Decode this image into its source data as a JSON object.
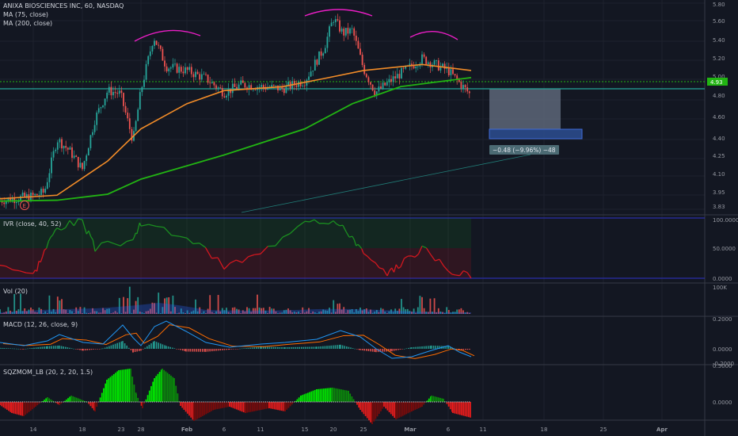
{
  "header": {
    "symbol_line": "ANIXA BIOSCIENCES INC, 60, NASDAQ",
    "ma75_label": "MA (75, close)",
    "ma200_label": "MA (200, close)"
  },
  "panes": {
    "ivr_label": "IVR (close, 40, 52)",
    "vol_label": "Vol (20)",
    "macd_label": "MACD (12, 26, close, 9)",
    "sqz_label": "SQZMOM_LB (20, 2, 20, 1.5)"
  },
  "price_axis": [
    "5.80",
    "5.60",
    "5.40",
    "5.20",
    "5.00",
    "4.80",
    "4.60",
    "4.40",
    "4.25",
    "4.10",
    "3.95",
    "3.83"
  ],
  "price_badge": "4.93",
  "ivr_axis": [
    "100.0000",
    "50.0000",
    "0.0000"
  ],
  "vol_axis": [
    "100K"
  ],
  "macd_axis": [
    "0.2000",
    "0.0000",
    "-0.2000"
  ],
  "sqz_axis": [
    "0.5000",
    "0.0000"
  ],
  "date_axis": [
    "14",
    "18",
    "23",
    "28",
    "Feb",
    "6",
    "11",
    "15",
    "20",
    "25",
    "Mar",
    "6",
    "11",
    "18",
    "25",
    "Apr"
  ],
  "position_label": "−0.48 (−9.96%) −48",
  "earnings_marker": "E",
  "colors": {
    "background": "#131722",
    "grid": "#1e222d",
    "up": "#26a69a",
    "down": "#ef5350",
    "ma75": "#f28c28",
    "ma200": "#22b413",
    "ivr_line_high": "#1b8f20",
    "ivr_line_low": "#d3171f",
    "band": "#2a2ea8",
    "arc": "#e91ec4",
    "price_line": "#26a69a",
    "macd": "#2196f3",
    "signal": "#ff6d00"
  },
  "chart_data": {
    "type": "candlestick",
    "ticker": "ANIXA BIOSCIENCES INC",
    "interval": "60",
    "exchange": "NASDAQ",
    "last_price": 4.93,
    "ylim": [
      3.8,
      5.85
    ],
    "price_path": [
      {
        "date": "Jan 11",
        "price": 3.88
      },
      {
        "date": "Jan 14",
        "price": 3.93
      },
      {
        "date": "Jan 15",
        "price": 3.97
      },
      {
        "date": "Jan 16",
        "price": 4.5
      },
      {
        "date": "Jan 17",
        "price": 4.38
      },
      {
        "date": "Jan 18",
        "price": 4.2
      },
      {
        "date": "Jan 22",
        "price": 4.7
      },
      {
        "date": "Jan 23",
        "price": 4.98
      },
      {
        "date": "Jan 24",
        "price": 4.95
      },
      {
        "date": "Jan 25",
        "price": 4.48
      },
      {
        "date": "Jan 28",
        "price": 4.98
      },
      {
        "date": "Jan 29",
        "price": 5.52
      },
      {
        "date": "Jan 30",
        "price": 5.22
      },
      {
        "date": "Feb 1",
        "price": 5.18
      },
      {
        "date": "Feb 4",
        "price": 5.1
      },
      {
        "date": "Feb 6",
        "price": 4.96
      },
      {
        "date": "Feb 8",
        "price": 5.04
      },
      {
        "date": "Feb 11",
        "price": 5.02
      },
      {
        "date": "Feb 13",
        "price": 5.0
      },
      {
        "date": "Feb 15",
        "price": 5.08
      },
      {
        "date": "Feb 19",
        "price": 5.4
      },
      {
        "date": "Feb 20",
        "price": 5.7
      },
      {
        "date": "Feb 21",
        "price": 5.55
      },
      {
        "date": "Feb 22",
        "price": 5.58
      },
      {
        "date": "Feb 25",
        "price": 5.2
      },
      {
        "date": "Feb 26",
        "price": 4.96
      },
      {
        "date": "Feb 28",
        "price": 5.1
      },
      {
        "date": "Mar 4",
        "price": 5.3
      },
      {
        "date": "Mar 6",
        "price": 5.18
      },
      {
        "date": "Mar 8",
        "price": 4.93
      }
    ],
    "ma75": [
      {
        "date": "Jan 11",
        "value": 3.9
      },
      {
        "date": "Jan 16",
        "value": 3.94
      },
      {
        "date": "Jan 23",
        "value": 4.28
      },
      {
        "date": "Jan 28",
        "value": 4.6
      },
      {
        "date": "Feb 1",
        "value": 4.85
      },
      {
        "date": "Feb 6",
        "value": 4.98
      },
      {
        "date": "Feb 13",
        "value": 5.02
      },
      {
        "date": "Feb 19",
        "value": 5.1
      },
      {
        "date": "Feb 25",
        "value": 5.18
      },
      {
        "date": "Mar 4",
        "value": 5.24
      },
      {
        "date": "Mar 8",
        "value": 5.18
      }
    ],
    "ma200": [
      {
        "date": "Jan 11",
        "value": 3.88
      },
      {
        "date": "Jan 16",
        "value": 3.89
      },
      {
        "date": "Jan 23",
        "value": 3.95
      },
      {
        "date": "Jan 28",
        "value": 4.1
      },
      {
        "date": "Feb 6",
        "value": 4.34
      },
      {
        "date": "Feb 15",
        "value": 4.6
      },
      {
        "date": "Feb 22",
        "value": 4.85
      },
      {
        "date": "Mar 1",
        "value": 5.02
      },
      {
        "date": "Mar 8",
        "value": 5.11
      }
    ],
    "horizontal_line": 4.87,
    "position_tool": {
      "entry": 4.87,
      "target": 4.39,
      "change": -0.48,
      "change_pct": -9.96,
      "ticks": -48
    },
    "ivr": [
      {
        "date": "Jan 11",
        "value": 30
      },
      {
        "date": "Jan 14",
        "value": 5
      },
      {
        "date": "Jan 15",
        "value": 45
      },
      {
        "date": "Jan 16",
        "value": 85
      },
      {
        "date": "Jan 18",
        "value": 95
      },
      {
        "date": "Jan 22",
        "value": 50
      },
      {
        "date": "Jan 25",
        "value": 65
      },
      {
        "date": "Jan 28",
        "value": 90
      },
      {
        "date": "Feb 1",
        "value": 70
      },
      {
        "date": "Feb 6",
        "value": 20
      },
      {
        "date": "Feb 11",
        "value": 40
      },
      {
        "date": "Feb 15",
        "value": 100
      },
      {
        "date": "Feb 20",
        "value": 95
      },
      {
        "date": "Feb 22",
        "value": 70
      },
      {
        "date": "Feb 25",
        "value": 40
      },
      {
        "date": "Feb 27",
        "value": 3
      },
      {
        "date": "Mar 1",
        "value": 25
      },
      {
        "date": "Mar 4",
        "value": 50
      },
      {
        "date": "Mar 6",
        "value": 15
      },
      {
        "date": "Mar 8",
        "value": 2
      }
    ],
    "ivr_ylim": [
      0,
      100
    ]
  }
}
